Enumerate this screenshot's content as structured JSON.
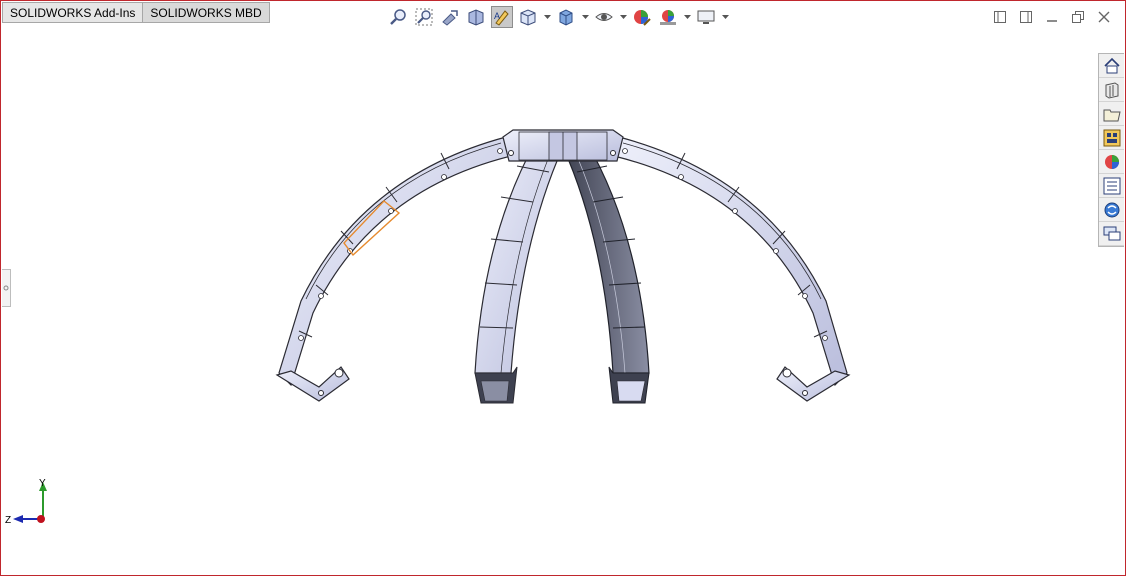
{
  "tabs": [
    {
      "label": "SOLIDWORKS Add-Ins"
    },
    {
      "label": "SOLIDWORKS MBD"
    }
  ],
  "heads_up_toolbar": {
    "tools": [
      {
        "icon": "zoom-to-fit-icon"
      },
      {
        "icon": "zoom-to-area-icon"
      },
      {
        "icon": "previous-view-icon"
      },
      {
        "icon": "section-view-icon"
      },
      {
        "icon": "dynamic-annotation-views-icon",
        "selected": true
      },
      {
        "icon": "view-orientation-icon",
        "dropdown": true
      },
      {
        "icon": "display-style-icon",
        "dropdown": true
      },
      {
        "icon": "hide-show-items-icon",
        "dropdown": true
      },
      {
        "icon": "edit-appearance-icon"
      },
      {
        "icon": "apply-scene-icon",
        "dropdown": true
      },
      {
        "icon": "view-settings-icon",
        "dropdown": true
      }
    ]
  },
  "window_controls": [
    "tile-left-icon",
    "tile-right-icon",
    "minimize-icon",
    "restore-icon",
    "close-icon"
  ],
  "task_pane": [
    "solidworks-resources-icon",
    "design-library-icon",
    "file-explorer-icon",
    "view-palette-icon",
    "appearances-scenes-decals-icon",
    "custom-properties-icon",
    "solidworks-forum-icon",
    "3dexperience-icon"
  ],
  "triad": {
    "y_label": "Y",
    "z_label": "Z",
    "colors": {
      "y": "#2c9a2c",
      "z": "#1c2ab0",
      "x": "#c0121e"
    }
  },
  "colors": {
    "frame_border": "#c0272d",
    "highlight": "#e68a2e",
    "part_light": "#d8dbf1",
    "part_dark": "#5a5d6e"
  }
}
